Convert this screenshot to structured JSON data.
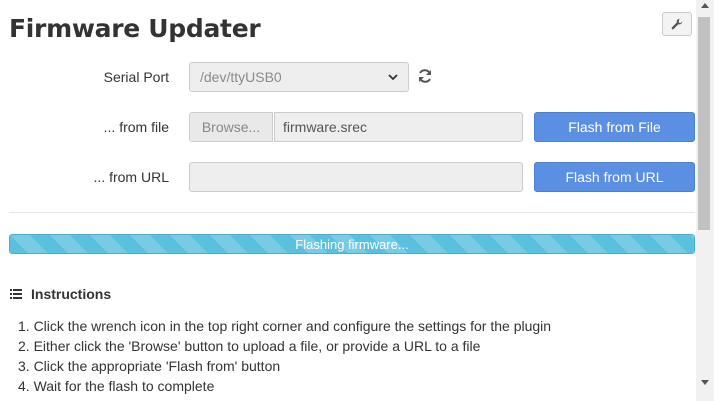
{
  "header": {
    "title": "Firmware Updater",
    "settings_icon": "wrench-icon"
  },
  "serial": {
    "label": "Serial Port",
    "selected": "/dev/ttyUSB0",
    "refresh_icon": "refresh-icon"
  },
  "from_file": {
    "label": "... from file",
    "browse_label": "Browse...",
    "file_value": "firmware.srec",
    "button_label": "Flash from File"
  },
  "from_url": {
    "label": "... from URL",
    "url_value": "",
    "button_label": "Flash from URL"
  },
  "progress": {
    "text": "Flashing firmware...",
    "fraction": 1.0
  },
  "instructions": {
    "heading": "Instructions",
    "icon": "list-icon",
    "steps": [
      "1. Click the wrench icon in the top right corner and configure the settings for the plugin",
      "2. Either click the 'Browse' button to upload a file, or provide a URL to a file",
      "3. Click the appropriate 'Flash from' button",
      "4. Wait for the flash to complete"
    ]
  },
  "colors": {
    "primary": "#5b8fe1",
    "progress": "#5bc0de"
  }
}
